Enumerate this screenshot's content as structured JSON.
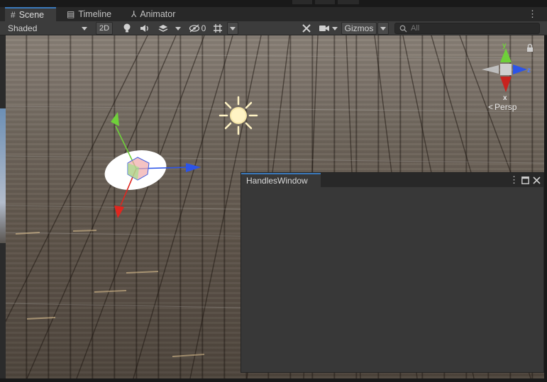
{
  "tabs": [
    {
      "label": "Scene",
      "icon": "hash-icon",
      "active": true
    },
    {
      "label": "Timeline",
      "icon": "timeline-icon",
      "active": false
    },
    {
      "label": "Animator",
      "icon": "animator-icon",
      "active": false
    }
  ],
  "toolbar": {
    "shading_mode": "Shaded",
    "mode_2d": "2D",
    "hidden_count": "0",
    "gizmos_label": "Gizmos",
    "search_placeholder": "All"
  },
  "gizmo": {
    "axis_y": "y",
    "axis_z": "z",
    "axis_x": "x",
    "projection": "Persp"
  },
  "handles_window": {
    "title": "HandlesWindow"
  },
  "colors": {
    "accent": "#3a79bb",
    "axis_x": "#e0261f",
    "axis_y": "#6fd03a",
    "axis_z": "#2c54e8"
  }
}
